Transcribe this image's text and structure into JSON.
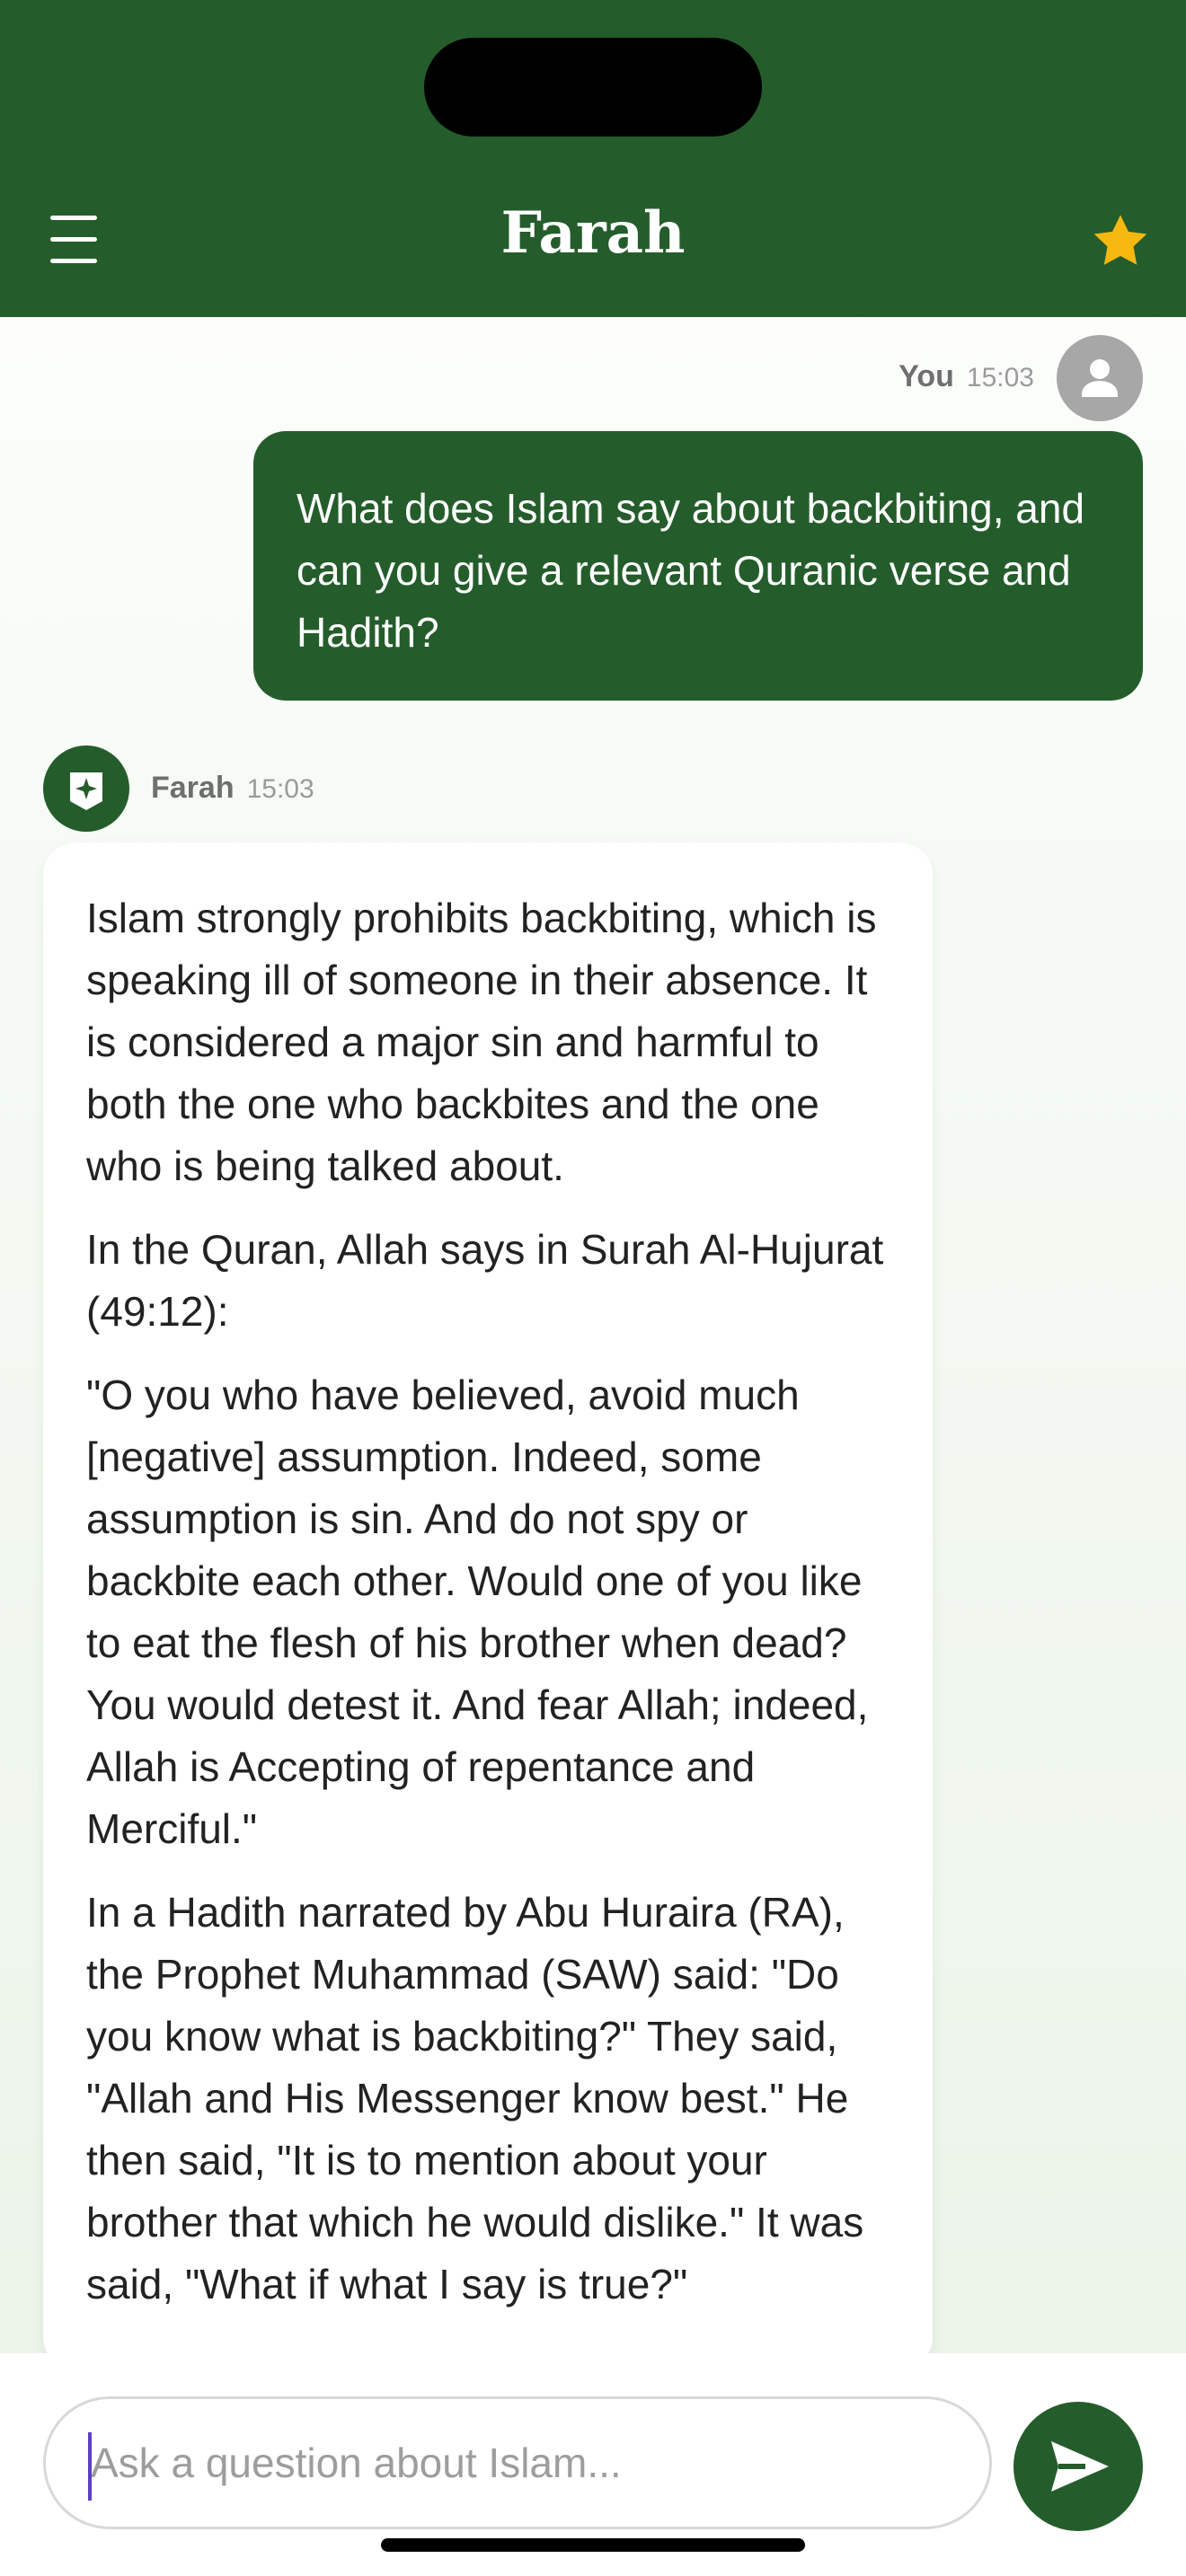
{
  "header": {
    "title": "Farah",
    "menu_icon": "hamburger-menu-icon",
    "favorite_icon": "star-icon",
    "colors": {
      "brand": "#245d2b",
      "star": "#f6b80f"
    }
  },
  "messages": {
    "user": {
      "sender": "You",
      "time": "15:03",
      "avatar_icon": "person-icon",
      "text": "What does Islam say about backbiting, and can you give a relevant Quranic verse and Hadith?"
    },
    "bot": {
      "sender": "Farah",
      "time": "15:03",
      "avatar_icon": "sparkle-badge-icon",
      "paragraphs": [
        "Islam strongly prohibits backbiting, which is speaking ill of someone in their absence. It is considered a major sin and harmful to both the one who backbites and the one who is being talked about.",
        "In the Quran, Allah says in Surah Al-Hujurat (49:12):",
        "\"O you who have believed, avoid much [negative] assumption. Indeed, some assumption is sin. And do not spy or backbite each other. Would one of you like to eat the flesh of his brother when dead? You would detest it. And fear Allah; indeed, Allah is Accepting of repentance and Merciful.\"",
        "In a Hadith narrated by Abu Huraira (RA), the Prophet Muhammad (SAW) said: \"Do you know what is backbiting?\" They said, \"Allah and His Messenger know best.\" He then said, \"It is to mention about your brother that which he would dislike.\" It was said, \"What if what I say is true?\""
      ]
    }
  },
  "composer": {
    "placeholder": "Ask a question about Islam...",
    "value": "",
    "send_icon": "send-icon"
  }
}
